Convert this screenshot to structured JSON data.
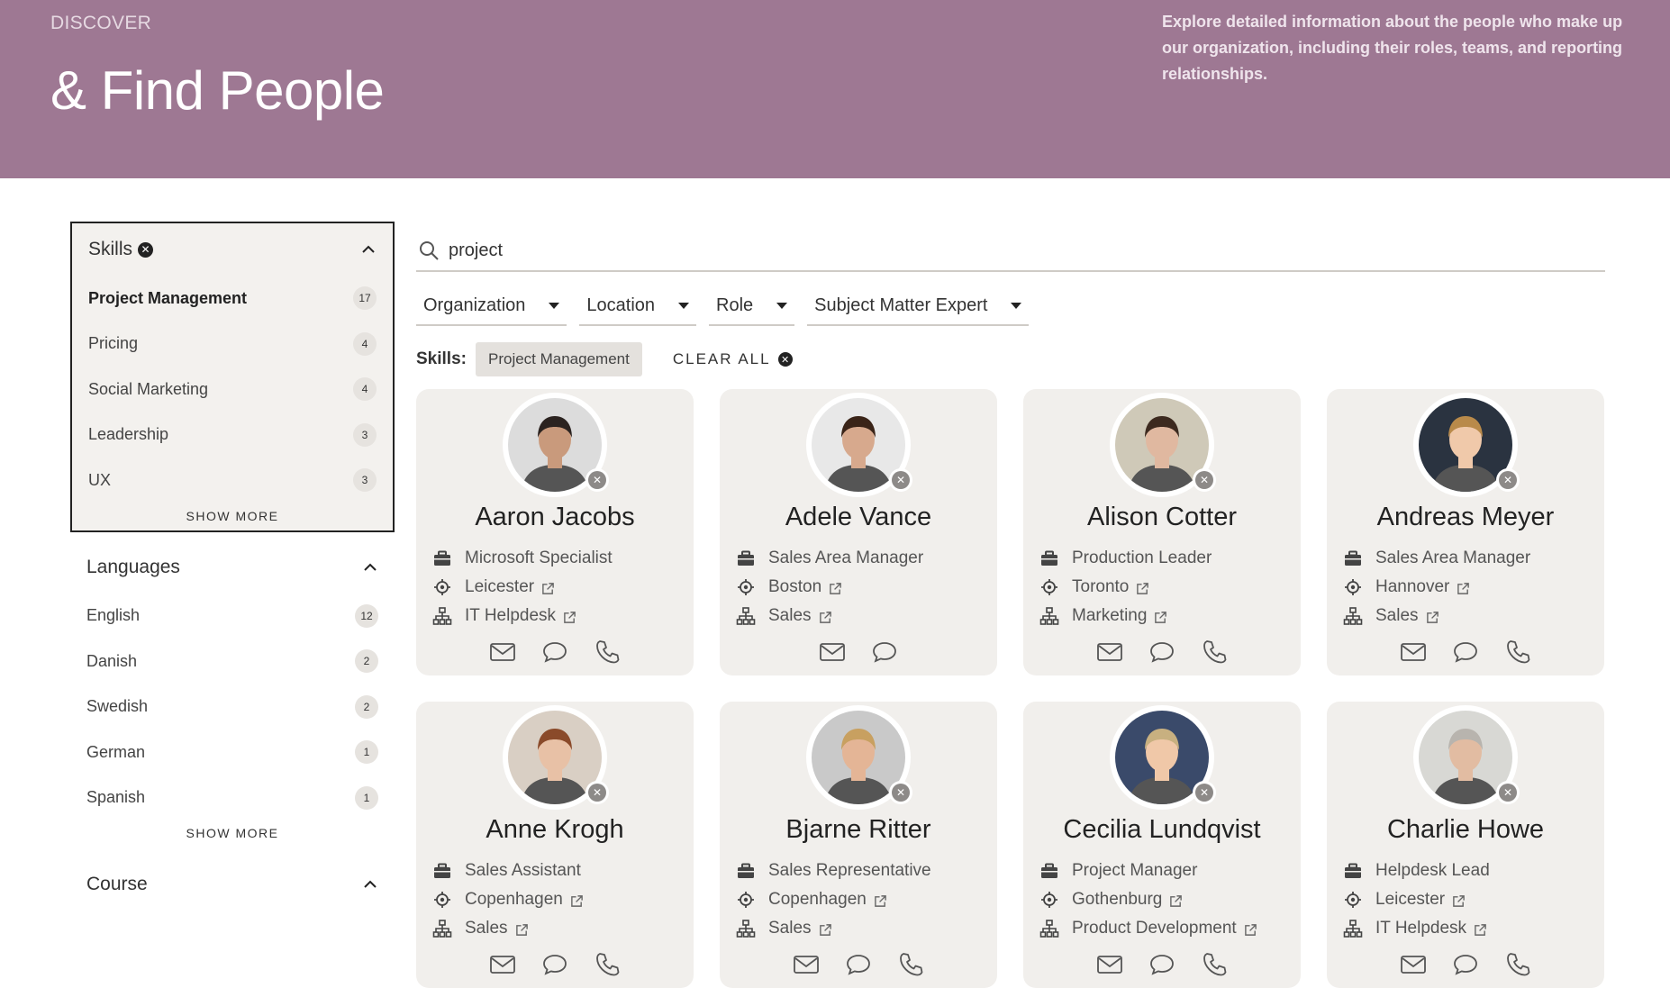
{
  "header": {
    "eyebrow": "DISCOVER",
    "title": "& Find People",
    "description": "Explore detailed information about the people who make up our organization, including their roles, teams, and reporting relationships."
  },
  "sidebar": {
    "skills": {
      "label": "Skills",
      "items": [
        {
          "label": "Project Management",
          "count": "17",
          "selected": true
        },
        {
          "label": "Pricing",
          "count": "4"
        },
        {
          "label": "Social Marketing",
          "count": "4"
        },
        {
          "label": "Leadership",
          "count": "3"
        },
        {
          "label": "UX",
          "count": "3"
        }
      ],
      "show_more": "SHOW MORE"
    },
    "languages": {
      "label": "Languages",
      "items": [
        {
          "label": "English",
          "count": "12"
        },
        {
          "label": "Danish",
          "count": "2"
        },
        {
          "label": "Swedish",
          "count": "2"
        },
        {
          "label": "German",
          "count": "1"
        },
        {
          "label": "Spanish",
          "count": "1"
        }
      ],
      "show_more": "SHOW MORE"
    },
    "course": {
      "label": "Course"
    }
  },
  "search": {
    "value": "project"
  },
  "filters": [
    "Organization",
    "Location",
    "Role",
    "Subject Matter Expert"
  ],
  "active_filters": {
    "label": "Skills:",
    "chip": "Project Management",
    "clear_all": "CLEAR ALL"
  },
  "people": [
    {
      "name": "Aaron Jacobs",
      "role": "Microsoft Specialist",
      "location": "Leicester",
      "department": "IT Helpdesk",
      "phone": true
    },
    {
      "name": "Adele Vance",
      "role": "Sales Area Manager",
      "location": "Boston",
      "department": "Sales",
      "phone": false
    },
    {
      "name": "Alison Cotter",
      "role": "Production Leader",
      "location": "Toronto",
      "department": "Marketing",
      "phone": true
    },
    {
      "name": "Andreas Meyer",
      "role": "Sales Area Manager",
      "location": "Hannover",
      "department": "Sales",
      "phone": true
    },
    {
      "name": "Anne Krogh",
      "role": "Sales Assistant",
      "location": "Copenhagen",
      "department": "Sales",
      "phone": true
    },
    {
      "name": "Bjarne Ritter",
      "role": "Sales Representative",
      "location": "Copenhagen",
      "department": "Sales",
      "phone": true
    },
    {
      "name": "Cecilia Lundqvist",
      "role": "Project Manager",
      "location": "Gothenburg",
      "department": "Product Development",
      "phone": true
    },
    {
      "name": "Charlie Howe",
      "role": "Helpdesk Lead",
      "location": "Leicester",
      "department": "IT Helpdesk",
      "phone": true
    }
  ],
  "colors": {
    "banner": "#9e7893",
    "card": "#f1efec"
  }
}
